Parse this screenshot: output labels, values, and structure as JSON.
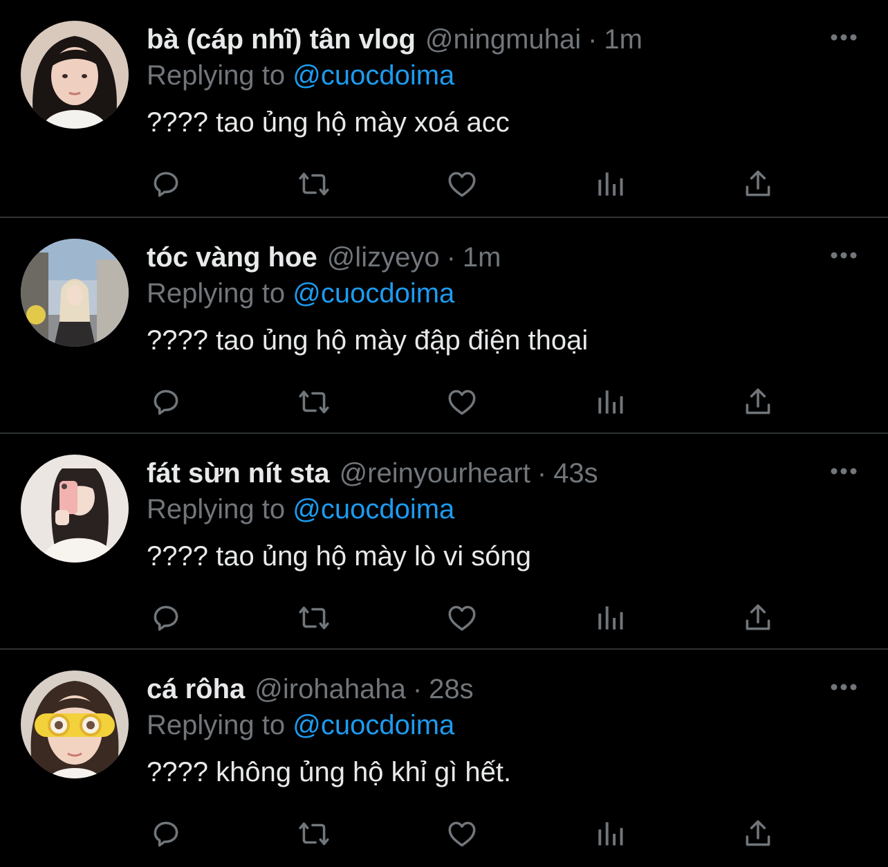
{
  "colors": {
    "background": "#000000",
    "primary_text": "#e7e9ea",
    "secondary_text": "#71767b",
    "link": "#1d9bf0",
    "divider": "#2f3336"
  },
  "icons": {
    "reply": "comment-bubble-icon",
    "retweet": "retweet-icon",
    "like": "heart-icon",
    "views": "bar-chart-icon",
    "share": "share-upload-icon",
    "more": "more-dots-icon"
  },
  "tweets": [
    {
      "display_name": "bà (cáp nhĩ) tân vlog",
      "handle": "@ningmuhai",
      "separator": "·",
      "time": "1m",
      "replying_prefix": "Replying to",
      "replying_to": "@cuocdoima",
      "text": "???? tao ủng hộ mày xoá acc"
    },
    {
      "display_name": "tóc vàng hoe",
      "handle": "@lizyeyo",
      "separator": "·",
      "time": "1m",
      "replying_prefix": "Replying to",
      "replying_to": "@cuocdoima",
      "text": "???? tao ủng hộ mày đập điện thoại"
    },
    {
      "display_name": "fát sừn nít sta",
      "handle": "@reinyourheart",
      "separator": "·",
      "time": "43s",
      "replying_prefix": "Replying to",
      "replying_to": "@cuocdoima",
      "text": "???? tao ủng hộ mày lò vi sóng"
    },
    {
      "display_name": "cá rôha",
      "handle": "@irohahaha",
      "separator": "·",
      "time": "28s",
      "replying_prefix": "Replying to",
      "replying_to": "@cuocdoima",
      "text": "???? không ủng hộ khỉ gì hết."
    }
  ]
}
